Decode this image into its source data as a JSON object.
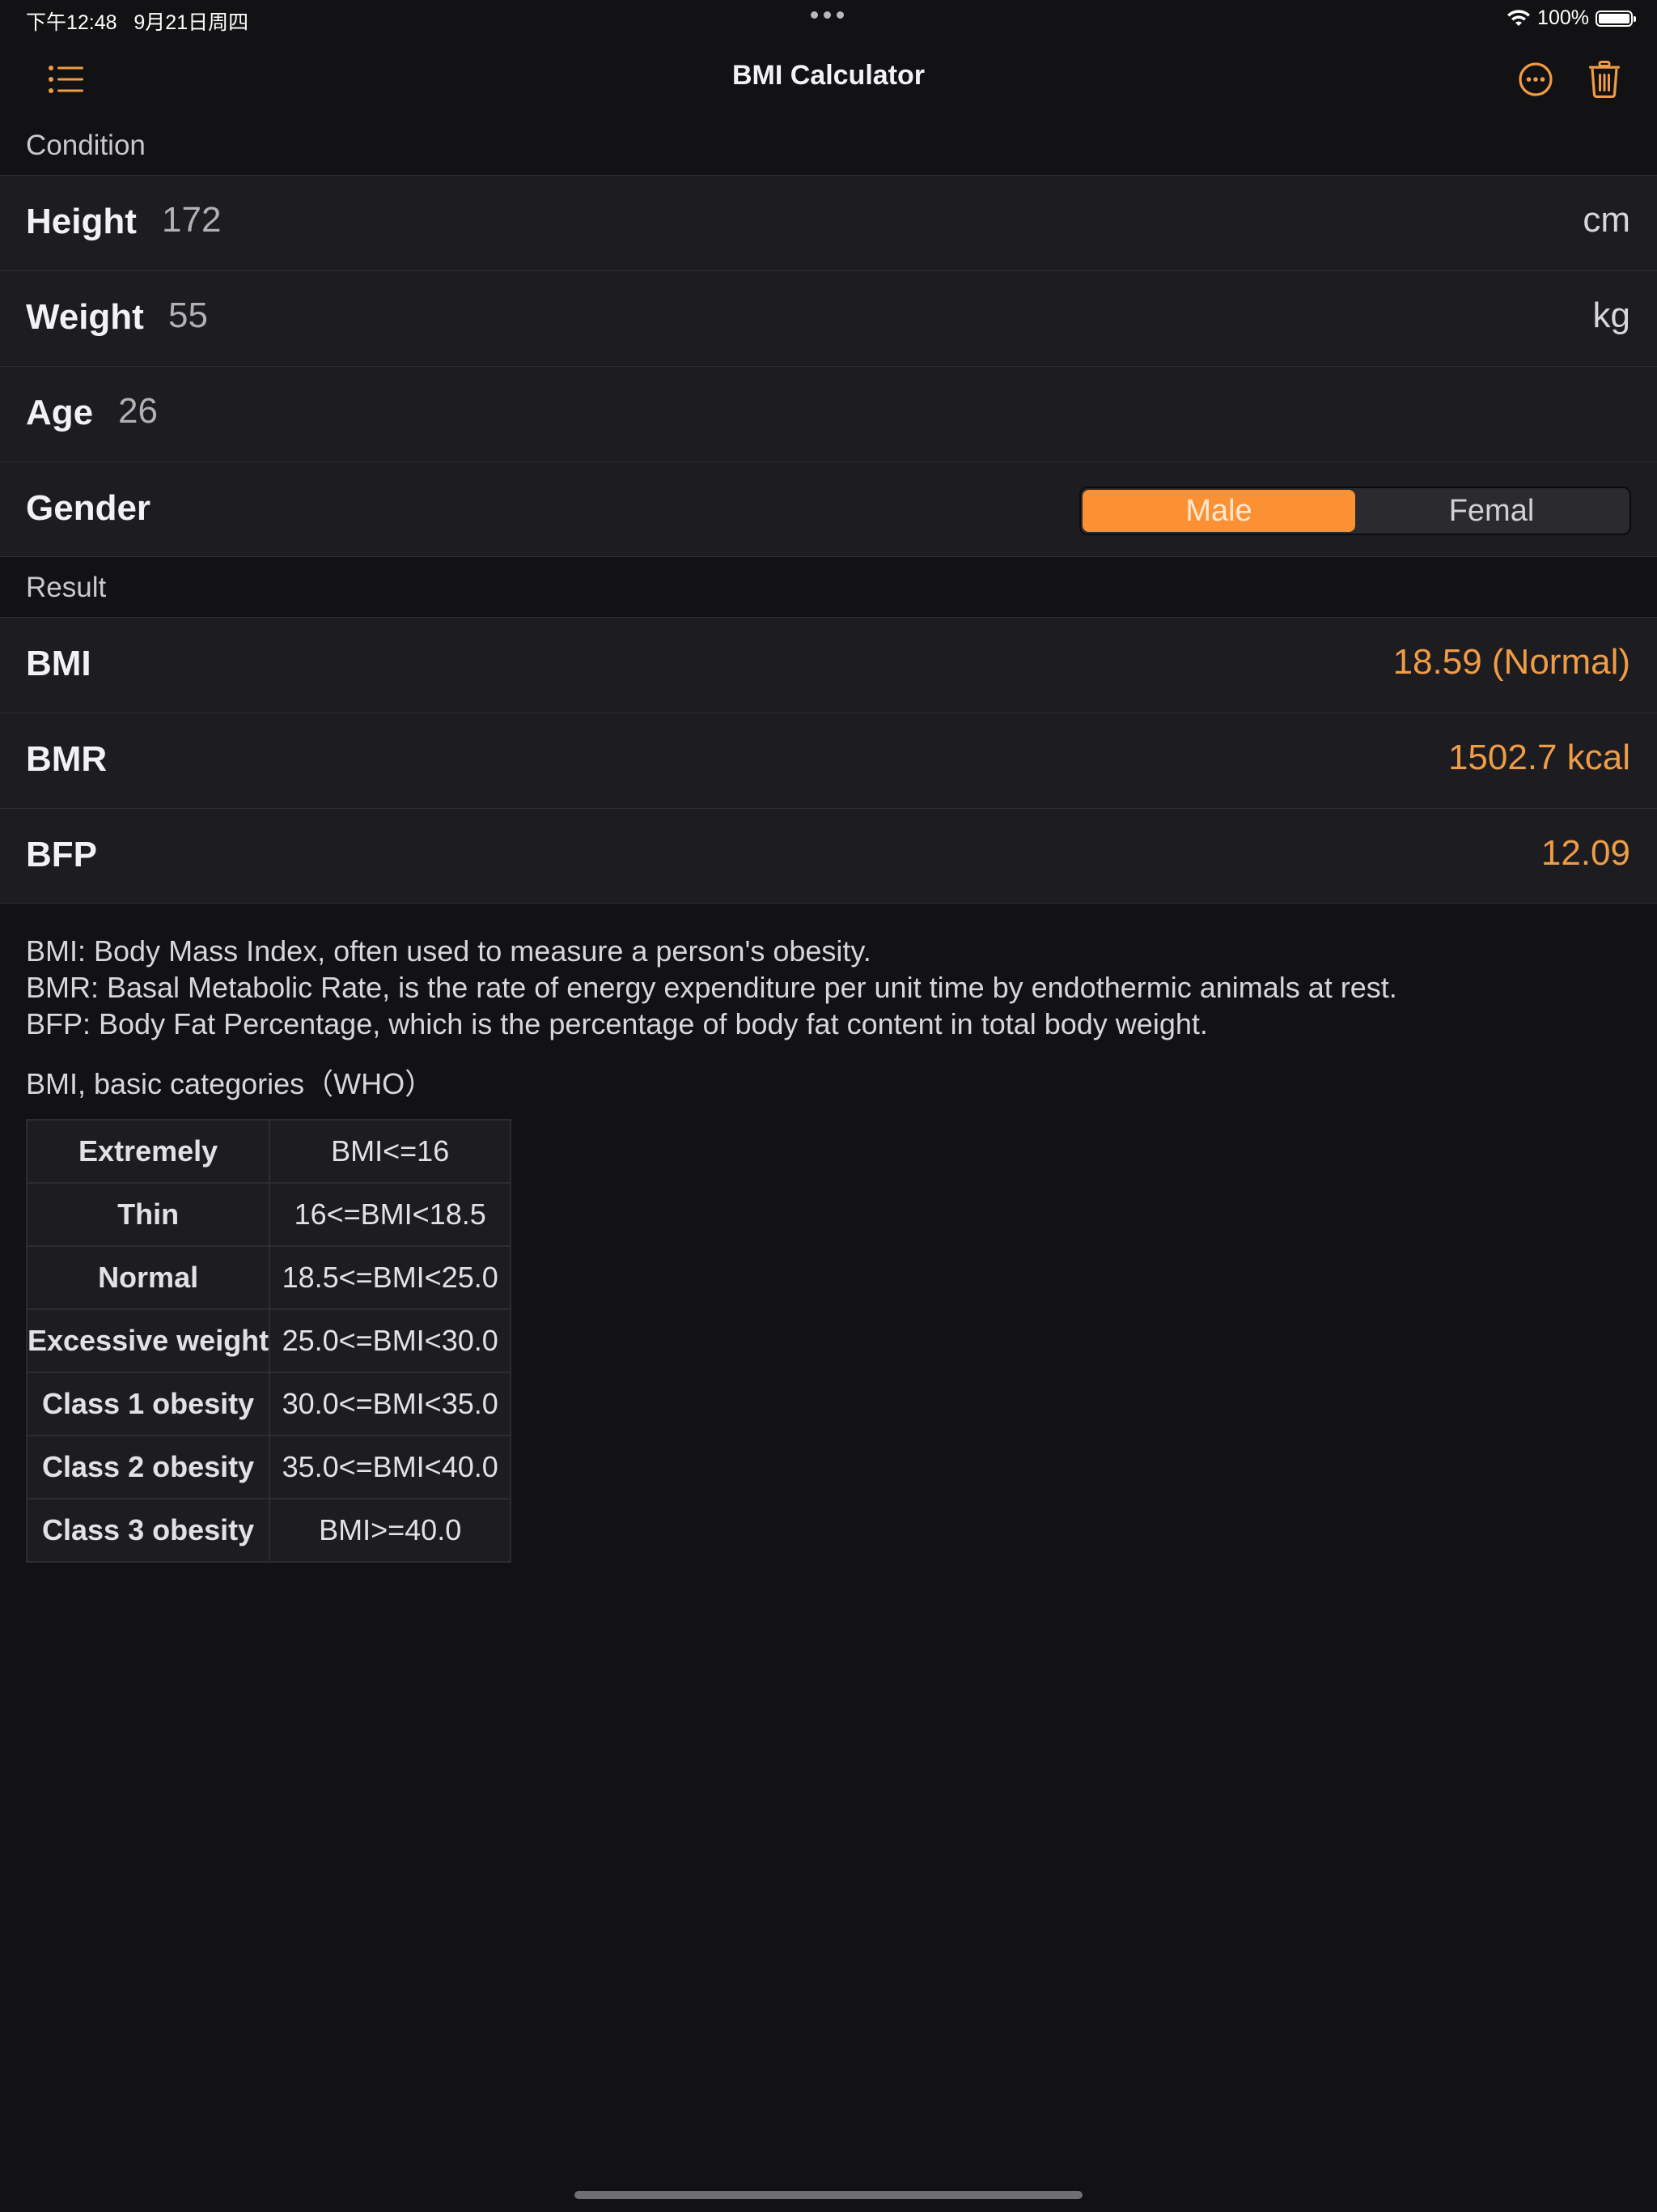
{
  "status_bar": {
    "time_date": "下午12:48   9月21日周四",
    "battery_percent": "100%",
    "battery_level": 1.0
  },
  "nav": {
    "title": "BMI Calculator",
    "left_icon": "list-icon",
    "right_icons": [
      "more-circle-icon",
      "trash-icon"
    ]
  },
  "condition": {
    "header": "Condition",
    "height": {
      "label": "Height",
      "value": "172",
      "unit": "cm"
    },
    "weight": {
      "label": "Weight",
      "value": "55",
      "unit": "kg"
    },
    "age": {
      "label": "Age",
      "value": "26"
    },
    "gender": {
      "label": "Gender",
      "options": [
        "Male",
        "Femal"
      ],
      "selected": "Male"
    }
  },
  "result": {
    "header": "Result",
    "bmi": {
      "label": "BMI",
      "value": "18.59 (Normal)"
    },
    "bmr": {
      "label": "BMR",
      "value": "1502.7 kcal"
    },
    "bfp": {
      "label": "BFP",
      "value": "12.09"
    }
  },
  "description": {
    "lines": [
      "BMI: Body Mass Index, often used to measure a person's obesity.",
      "BMR: Basal Metabolic Rate, is the rate of energy expenditure per unit time by endothermic animals at rest.",
      "BFP: Body Fat Percentage, which is the percentage of body fat content in total body weight."
    ],
    "table_title": "BMI, basic categories（WHO）"
  },
  "bmi_table": [
    {
      "category": "Extremely",
      "range": "BMI<=16"
    },
    {
      "category": "Thin",
      "range": "16<=BMI<18.5"
    },
    {
      "category": "Normal",
      "range": "18.5<=BMI<25.0"
    },
    {
      "category": "Excessive weight",
      "range": "25.0<=BMI<30.0"
    },
    {
      "category": "Class 1 obesity",
      "range": "30.0<=BMI<35.0"
    },
    {
      "category": "Class 2 obesity",
      "range": "35.0<=BMI<40.0"
    },
    {
      "category": "Class 3 obesity",
      "range": "BMI>=40.0"
    }
  ],
  "colors": {
    "accent": "#fc9133",
    "value_text": "#ef9c45",
    "background": "#121214",
    "cell_background": "#1c1c21"
  }
}
